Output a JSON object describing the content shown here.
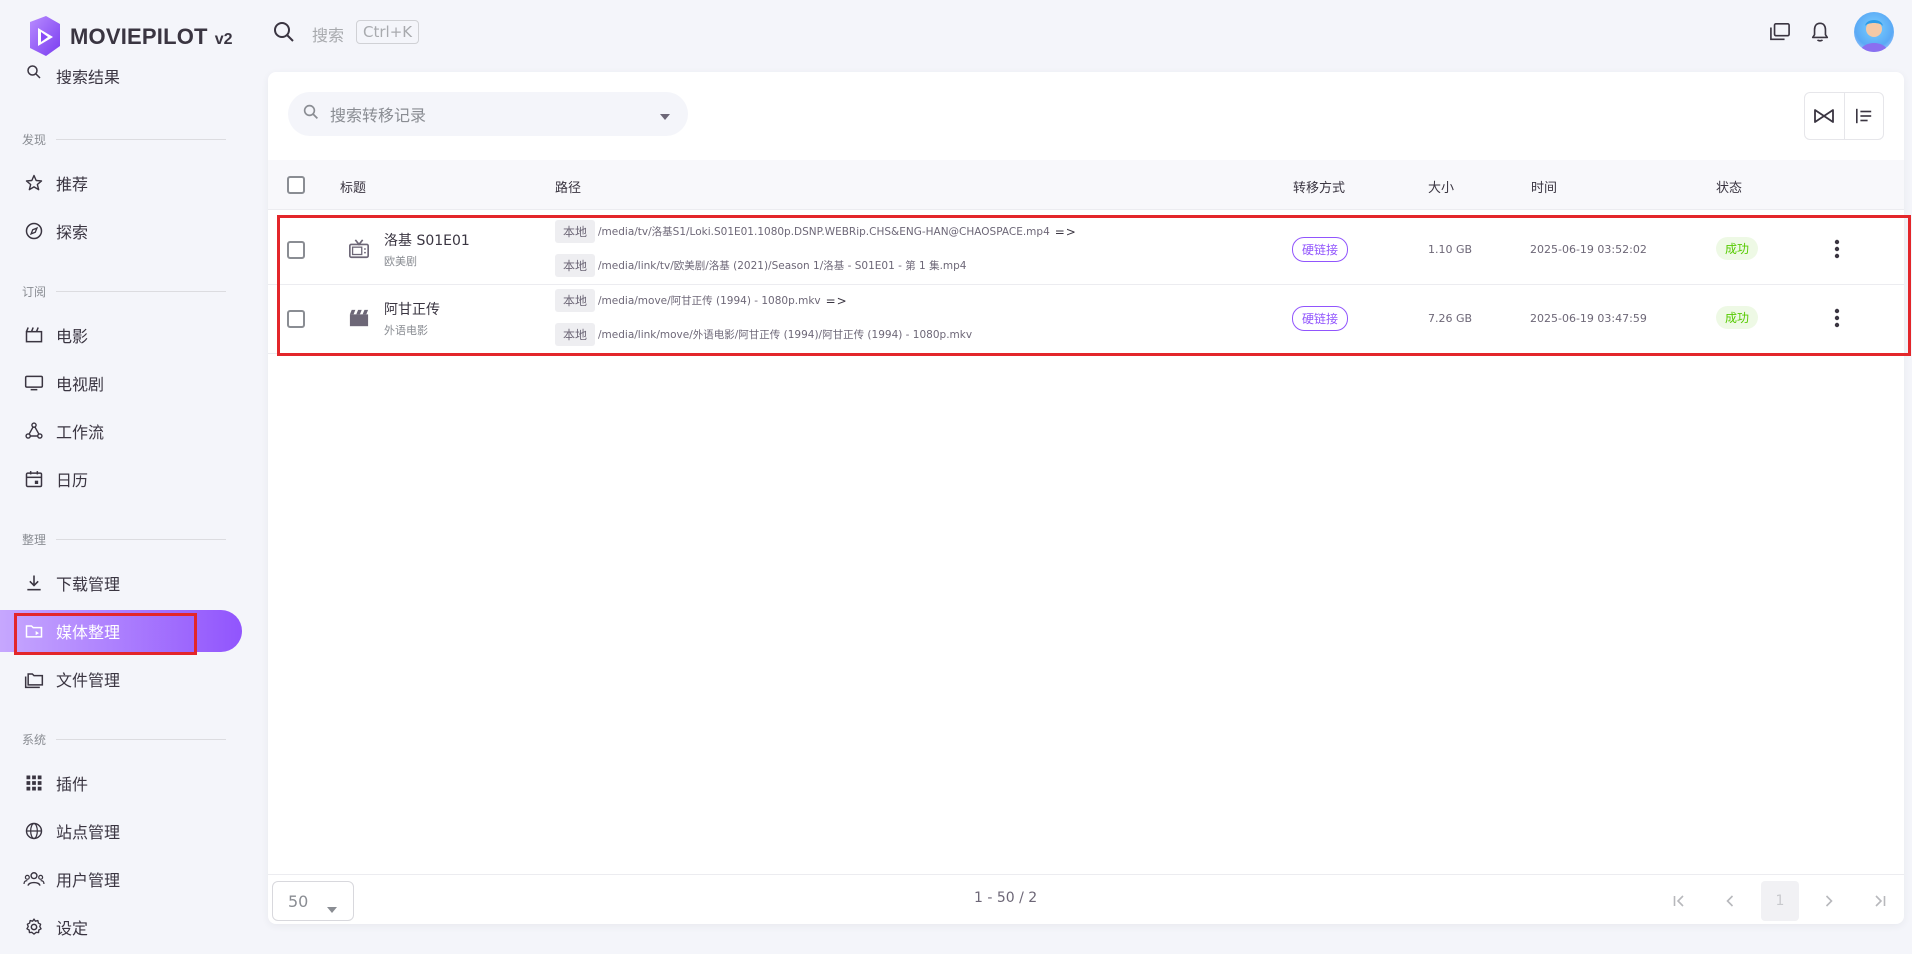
{
  "app": {
    "name": "MOVIEPILOT",
    "version": "v2",
    "brand_color": "#9155fd"
  },
  "header": {
    "search_label": "搜索",
    "search_shortcut": "Ctrl+K",
    "icons": [
      "window-icon",
      "bell-icon",
      "avatar"
    ]
  },
  "sidebar": {
    "top_partial_item": "搜索结果",
    "sections": [
      {
        "label": "发现",
        "items": [
          {
            "label": "推荐",
            "icon": "star-icon"
          },
          {
            "label": "探索",
            "icon": "compass-icon"
          }
        ]
      },
      {
        "label": "订阅",
        "items": [
          {
            "label": "电影",
            "icon": "movie-icon"
          },
          {
            "label": "电视剧",
            "icon": "tv-icon"
          },
          {
            "label": "工作流",
            "icon": "workflow-icon"
          },
          {
            "label": "日历",
            "icon": "calendar-icon"
          }
        ]
      },
      {
        "label": "整理",
        "items": [
          {
            "label": "下载管理",
            "icon": "download-icon"
          },
          {
            "label": "媒体整理",
            "icon": "folder-play-icon",
            "active": true
          },
          {
            "label": "文件管理",
            "icon": "folders-icon"
          }
        ]
      },
      {
        "label": "系统",
        "items": [
          {
            "label": "插件",
            "icon": "grid-icon"
          },
          {
            "label": "站点管理",
            "icon": "globe-icon"
          },
          {
            "label": "用户管理",
            "icon": "users-icon"
          },
          {
            "label": "设定",
            "icon": "gear-icon"
          }
        ]
      }
    ]
  },
  "main": {
    "filter_placeholder": "搜索转移记录",
    "columns": [
      "标题",
      "路径",
      "转移方式",
      "大小",
      "时间",
      "状态"
    ],
    "rows": [
      {
        "icon": "tv-icon",
        "title": "洛基 S01E01",
        "subtitle": "欧美剧",
        "src_tag": "本地",
        "src_path": "/media/tv/洛基S1/Loki.S01E01.1080p.DSNP.WEBRip.CHS&ENG-HAN@CHAOSPACE.mp4",
        "arrow": "=>",
        "dst_tag": "本地",
        "dst_path": "/media/link/tv/欧美剧/洛基 (2021)/Season 1/洛基 - S01E01 - 第 1 集.mp4",
        "mode": "硬链接",
        "size": "1.10 GB",
        "time": "2025-06-19 03:52:02",
        "status": "成功"
      },
      {
        "icon": "clapper-icon",
        "title": "阿甘正传",
        "subtitle": "外语电影",
        "src_tag": "本地",
        "src_path": "/media/move/阿甘正传 (1994) - 1080p.mkv",
        "arrow": "=>",
        "dst_tag": "本地",
        "dst_path": "/media/link/move/外语电影/阿甘正传 (1994)/阿甘正传 (1994) - 1080p.mkv",
        "mode": "硬链接",
        "size": "7.26 GB",
        "time": "2025-06-19 03:47:59",
        "status": "成功"
      }
    ],
    "footer": {
      "per_page": "50",
      "range": "1 - 50 / 2",
      "current_page": "1"
    }
  },
  "colors": {
    "status_success": "#56ca00",
    "highlight_outline": "#e3262a"
  }
}
